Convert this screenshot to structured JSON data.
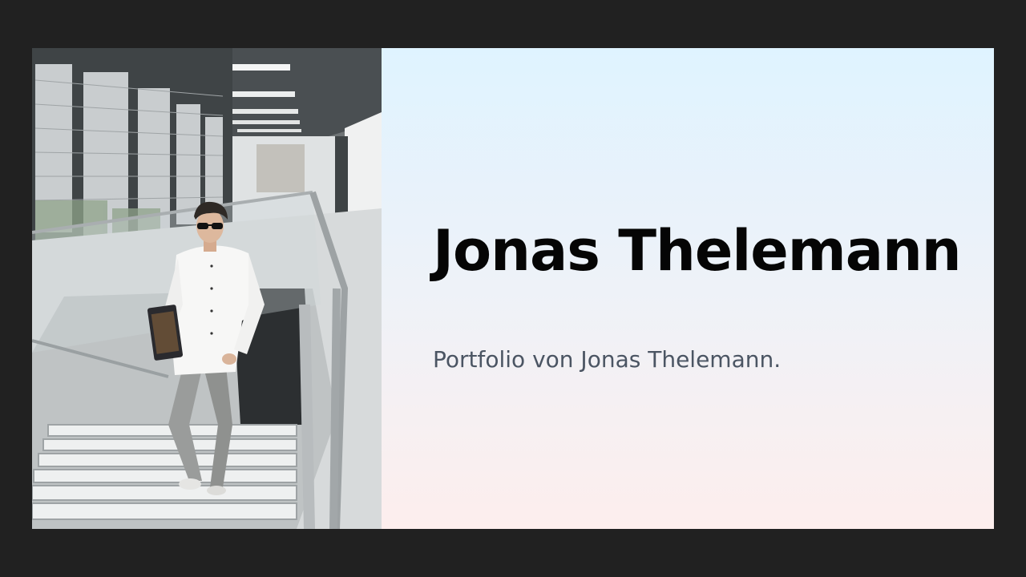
{
  "hero": {
    "title": "Jonas Thelemann",
    "subtitle": "Portfolio von Jonas Thelemann."
  },
  "photo": {
    "subject": "person-on-staircase"
  },
  "colors": {
    "page_background": "#212121",
    "title": "#050505",
    "subtitle": "#4b5563",
    "gradient_top": "#dff3ff",
    "gradient_bottom": "#fdeeed"
  }
}
